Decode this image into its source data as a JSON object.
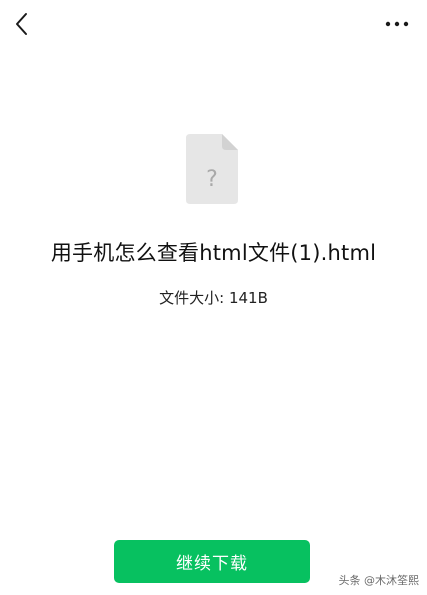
{
  "header": {
    "back_icon": "chevron-left-icon",
    "more_icon": "more-horizontal-icon"
  },
  "file": {
    "icon": "unknown-file-icon",
    "icon_glyph": "?",
    "name": "用手机怎么查看html文件(1).html",
    "size_label": "文件大小: 141B"
  },
  "actions": {
    "download_label": "继续下载"
  },
  "watermark": {
    "text": "头条 @木沐筌熙"
  },
  "colors": {
    "accent": "#07c160",
    "file_icon": "#e6e6e6",
    "file_icon_fold": "#d2d2d2"
  }
}
